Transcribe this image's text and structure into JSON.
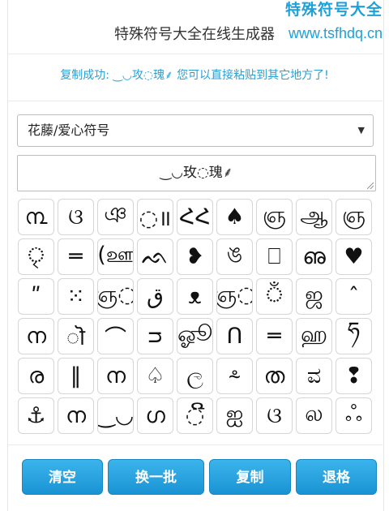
{
  "title": "特殊符号大全在线生成器",
  "watermark": {
    "line1": "特殊符号大全",
    "line2": "www.tsfhdq.cn"
  },
  "status": "复制成功: ‿◡攻◌瑰⸙ 您可以直接粘贴到其它地方了!",
  "select": {
    "selected": "花藤/爱心符号"
  },
  "output": {
    "value": "‿◡玫◌瑰⸙"
  },
  "symbols": [
    "൩",
    "ଓ",
    "ঞ",
    "◌॥",
    "ՀՀ",
    "♠",
    "ஞ",
    "ஆ",
    "ஞ",
    "◌ৃ",
    "═",
    "(ஊ",
    "ᨒ",
    "❥",
    "ঙ",
    "⎕",
    "ഌ",
    "♥",
    "ʺ",
    "⁙",
    "ஞ◌",
    "ق",
    "ᴥ",
    "ஞ◌",
    "ঁ",
    "ஜ",
    "ˆ",
    "ന",
    "ॊ",
    "⌒",
    "ᴝ",
    "ஓூ",
    "ᑎ",
    "═",
    "ஹ",
    "ཧ",
    "ര",
    "‖",
    "ന",
    "♤",
    "ල",
    "⸛",
    "ത",
    "ವ",
    "❢",
    "⚓",
    "ന",
    "‿◡",
    "ഗ",
    "◌ີ",
    "ஐ",
    "ଓ",
    "ல",
    "ஃ"
  ],
  "buttons": {
    "clear": "清空",
    "batch": "换一批",
    "copy": "复制",
    "backspace": "退格"
  },
  "colors": {
    "accent": "#1ea0d8",
    "button": "#2ba7e3"
  }
}
